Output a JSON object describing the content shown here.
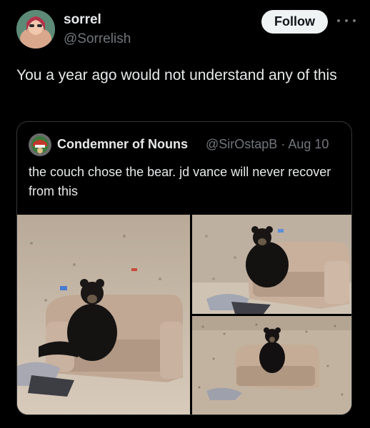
{
  "post": {
    "author": {
      "display_name": "sorrel",
      "handle": "@Sorrelish",
      "avatar_icon": "profile-photo-avatar"
    },
    "follow_label": "Follow",
    "more_icon": "more-horizontal-icon",
    "text": "You a year ago would not understand any of this"
  },
  "quote": {
    "author": {
      "display_name": "Condemner of Nouns",
      "handle": "@SirOstapB",
      "date": "Aug 10",
      "separator": "·",
      "avatar_icon": "profile-photo-avatar"
    },
    "text": "the couch chose the bear. jd vance will never recover from this",
    "media": [
      {
        "description_icon": "photo-bear-on-couch-wide"
      },
      {
        "description_icon": "photo-bear-on-couch-closeup"
      },
      {
        "description_icon": "photo-bear-on-couch-distant"
      }
    ]
  },
  "colors": {
    "background": "#000000",
    "primary_text": "#e7e9ea",
    "secondary_text": "#71767b",
    "border": "#333639",
    "follow_button_bg": "#eff3f4"
  }
}
